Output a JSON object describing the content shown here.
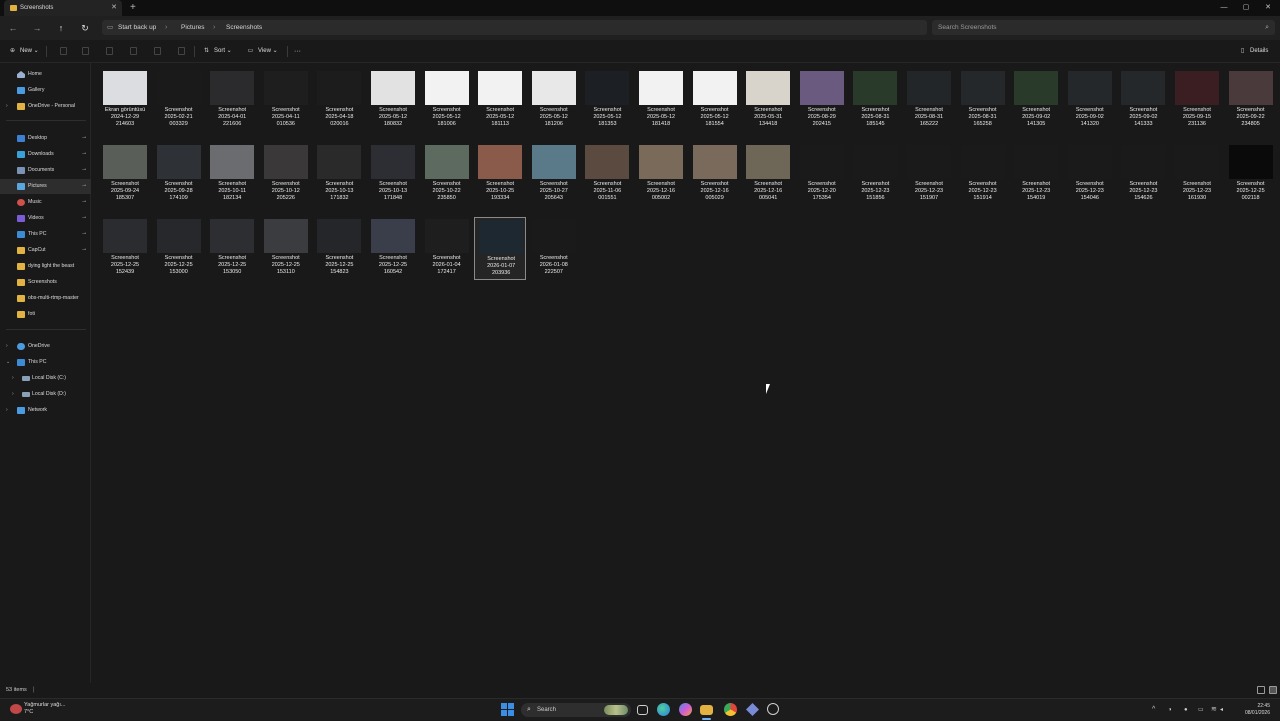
{
  "window": {
    "tab_title": "Screenshots",
    "new_tab_glyph": "+",
    "controls": {
      "minimize": "—",
      "maximize": "▢",
      "close": "✕"
    }
  },
  "nav": {
    "back": "←",
    "forward": "→",
    "up": "↑",
    "refresh": "↻"
  },
  "breadcrumb": {
    "item1": "Start back up",
    "item2": "Pictures",
    "item3": "Screenshots",
    "sep": "›"
  },
  "search": {
    "placeholder": "Search Screenshots",
    "icon": "⌕"
  },
  "toolbar": {
    "new_label": "New",
    "sort_label": "Sort",
    "view_label": "View",
    "more_label": "···",
    "details_label": "Details",
    "new_icon": "⊕",
    "sort_icon": "⇅",
    "view_icon": "▭",
    "details_icon": "▯"
  },
  "sidebar": {
    "quick": [
      {
        "label": "Home",
        "icon": "home-icon",
        "color": "#9ab0d0"
      },
      {
        "label": "Gallery",
        "icon": "gallery-icon",
        "color": "#4b9be0"
      },
      {
        "label": "OneDrive - Personal",
        "icon": "onedrive-icon",
        "color": "#e3b341"
      }
    ],
    "pinned": [
      {
        "label": "Desktop",
        "color": "#3d7fd1"
      },
      {
        "label": "Downloads",
        "color": "#3aa0d8"
      },
      {
        "label": "Documents",
        "color": "#7a93b5"
      },
      {
        "label": "Pictures",
        "color": "#5aa7e0"
      },
      {
        "label": "Music",
        "color": "#d0504a"
      },
      {
        "label": "Videos",
        "color": "#7c5cd6"
      },
      {
        "label": "This PC",
        "color": "#3d8bd5"
      },
      {
        "label": "CapCut",
        "color": "#e3b341"
      }
    ],
    "folders": [
      {
        "label": "dying light the beast"
      },
      {
        "label": "Screenshots"
      },
      {
        "label": "obs-multi-rtmp-master"
      },
      {
        "label": "foti"
      }
    ],
    "tree": [
      {
        "label": "OneDrive",
        "color": "#4b9be0"
      },
      {
        "label": "This PC",
        "color": "#3d8bd5"
      },
      {
        "label": "Local Disk (C:)",
        "color": "#8aa0b8"
      },
      {
        "label": "Local Disk (D:)",
        "color": "#8aa0b8"
      },
      {
        "label": "Network",
        "color": "#4b9be0"
      }
    ],
    "pin_glyph": "📌",
    "chevron": "›",
    "chevron_open": "⌄"
  },
  "files": [
    {
      "name": "Ekran görüntüsü\n2024-12-29\n214603",
      "bg": "#dcdde0"
    },
    {
      "name": "Screenshot\n2025-02-21\n003329",
      "bg": "#1a1a1a"
    },
    {
      "name": "Screenshot\n2025-04-01\n221606",
      "bg": "#2b2b2e"
    },
    {
      "name": "Screenshot\n2025-04-11\n010536",
      "bg": "#1e1e1e"
    },
    {
      "name": "Screenshot\n2025-04-18\n020016",
      "bg": "#1c1c1c"
    },
    {
      "name": "Screenshot\n2025-05-12\n180832",
      "bg": "#e2e2e2"
    },
    {
      "name": "Screenshot\n2025-05-12\n181006",
      "bg": "#f2f2f2"
    },
    {
      "name": "Screenshot\n2025-05-12\n181113",
      "bg": "#f2f2f2"
    },
    {
      "name": "Screenshot\n2025-05-12\n181206",
      "bg": "#e8e8e8"
    },
    {
      "name": "Screenshot\n2025-05-12\n181353",
      "bg": "#1c2024"
    },
    {
      "name": "Screenshot\n2025-05-12\n181418",
      "bg": "#f2f2f2"
    },
    {
      "name": "Screenshot\n2025-05-12\n181554",
      "bg": "#f2f2f2"
    },
    {
      "name": "Screenshot\n2025-05-31\n134418",
      "bg": "#d8d4cc"
    },
    {
      "name": "Screenshot\n2025-08-29\n202415",
      "bg": "#6a5a80"
    },
    {
      "name": "Screenshot\n2025-08-31\n185145",
      "bg": "#2a3a2a"
    },
    {
      "name": "Screenshot\n2025-08-31\n165222",
      "bg": "#222628"
    },
    {
      "name": "Screenshot\n2025-08-31\n165258",
      "bg": "#24282a"
    },
    {
      "name": "Screenshot\n2025-09-02\n141305",
      "bg": "#2a3a2a"
    },
    {
      "name": "Screenshot\n2025-09-02\n141320",
      "bg": "#24282a"
    },
    {
      "name": "Screenshot\n2025-09-02\n141333",
      "bg": "#24282a"
    },
    {
      "name": "Screenshot\n2025-09-15\n231136",
      "bg": "#3a1e22"
    },
    {
      "name": "Screenshot\n2025-09-22\n234805",
      "bg": "#4a3a3c"
    },
    {
      "name": "Screenshot\n2025-09-24\n185307",
      "bg": "#5a5e58"
    },
    {
      "name": "Screenshot\n2025-09-28\n174109",
      "bg": "#2e3236"
    },
    {
      "name": "Screenshot\n2025-10-11\n182134",
      "bg": "#6a6c70"
    },
    {
      "name": "Screenshot\n2025-10-12\n205226",
      "bg": "#3a3838"
    },
    {
      "name": "Screenshot\n2025-10-13\n171832",
      "bg": "#2a2a2a"
    },
    {
      "name": "Screenshot\n2025-10-13\n171848",
      "bg": "#2c2e34"
    },
    {
      "name": "Screenshot\n2025-10-22\n235850",
      "bg": "#5c6a60"
    },
    {
      "name": "Screenshot\n2025-10-25\n193334",
      "bg": "#8a5a4a"
    },
    {
      "name": "Screenshot\n2025-10-27\n205643",
      "bg": "#5a7a8a"
    },
    {
      "name": "Screenshot\n2025-11-06\n001551",
      "bg": "#5a4a40"
    },
    {
      "name": "Screenshot\n2025-12-16\n005002",
      "bg": "#7a6a5a"
    },
    {
      "name": "Screenshot\n2025-12-16\n005029",
      "bg": "#7a6a5c"
    },
    {
      "name": "Screenshot\n2025-12-16\n005041",
      "bg": "#6e6656"
    },
    {
      "name": "Screenshot\n2025-12-20\n175354",
      "bg": "#1a1a1a"
    },
    {
      "name": "Screenshot\n2025-12-23\n151856",
      "bg": "#1a1a1a"
    },
    {
      "name": "Screenshot\n2025-12-23\n151907",
      "bg": "#1a1a1a"
    },
    {
      "name": "Screenshot\n2025-12-23\n151914",
      "bg": "#1a1a1a"
    },
    {
      "name": "Screenshot\n2025-12-23\n154019",
      "bg": "#1a1a1a"
    },
    {
      "name": "Screenshot\n2025-12-23\n154046",
      "bg": "#1a1a1a"
    },
    {
      "name": "Screenshot\n2025-12-23\n154626",
      "bg": "#1a1a1a"
    },
    {
      "name": "Screenshot\n2025-12-23\n161930",
      "bg": "#1a1a1a"
    },
    {
      "name": "Screenshot\n2025-12-25\n002118",
      "bg": "#0a0a0a"
    },
    {
      "name": "Screenshot\n2025-12-25\n152439",
      "bg": "#2a2c30"
    },
    {
      "name": "Screenshot\n2025-12-25\n153000",
      "bg": "#26282c"
    },
    {
      "name": "Screenshot\n2025-12-25\n153050",
      "bg": "#2c2e32"
    },
    {
      "name": "Screenshot\n2025-12-25\n153110",
      "bg": "#3a3c40"
    },
    {
      "name": "Screenshot\n2025-12-25\n154823",
      "bg": "#24262a"
    },
    {
      "name": "Screenshot\n2025-12-25\n160542",
      "bg": "#3a3e4a"
    },
    {
      "name": "Screenshot\n2026-01-04\n172417",
      "bg": "#1e1e1e"
    },
    {
      "name": "Screenshot\n2026-01-07\n203936",
      "bg": "#1e2830",
      "selected": true
    },
    {
      "name": "Screenshot\n2026-01-08\n222507",
      "bg": "#1a1a1a"
    }
  ],
  "status": {
    "item_count": "53 items",
    "sep": "|"
  },
  "taskbar": {
    "weather_text": "Yağmurlar yağı...",
    "weather_temp": "7°C",
    "search_label": "Search",
    "search_icon": "⌕",
    "clock_time": "22:45",
    "clock_date": "08/01/2026",
    "tray": {
      "chevron": "^",
      "mic": "🎙",
      "wifi": "≋",
      "speaker": "🔊"
    },
    "apps": [
      {
        "name": "start-icon",
        "color": "#3a8ee6"
      },
      {
        "name": "task-view-icon",
        "color": "#cfcfcf"
      },
      {
        "name": "edge-icon",
        "color": "#2b9be0"
      },
      {
        "name": "copilot-icon",
        "color": "#d05ad6"
      },
      {
        "name": "file-explorer-icon",
        "color": "#e3b341"
      },
      {
        "name": "chrome-icon",
        "color": "#e0463a"
      },
      {
        "name": "vpn-icon",
        "color": "#7a8ad6"
      },
      {
        "name": "obs-icon",
        "color": "#cfcfcf"
      }
    ]
  }
}
